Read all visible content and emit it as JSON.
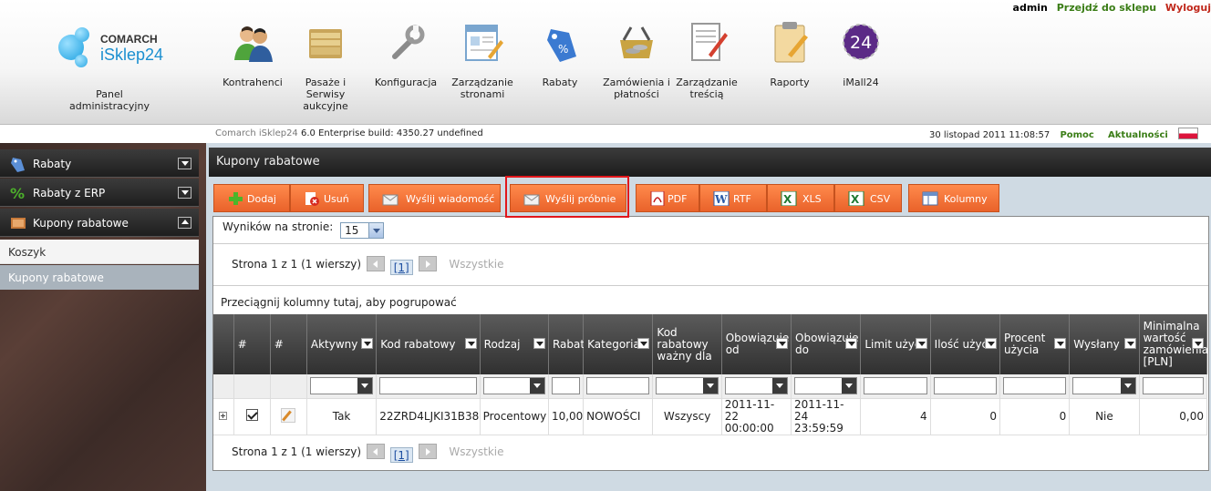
{
  "user_links": {
    "user": "admin",
    "shop": "Przejdź do sklepu",
    "logout": "Wyloguj"
  },
  "logo": {
    "brand": "COMARCH",
    "product": "iSklep24",
    "panel": "Panel administracyjny"
  },
  "nav": [
    {
      "label": "Kontrahenci",
      "icon": "contractors-icon"
    },
    {
      "label": "Pasaże i Serwisy aukcyjne",
      "icon": "auction-folder-icon"
    },
    {
      "label": "Konfiguracja",
      "icon": "wrench-icon"
    },
    {
      "label": "Zarządzanie stronami",
      "icon": "pages-icon"
    },
    {
      "label": "Rabaty",
      "icon": "discount-tag-icon"
    },
    {
      "label": "Zamówienia i płatności",
      "icon": "orders-basket-icon"
    },
    {
      "label": "Zarządzanie treścią",
      "icon": "content-edit-icon"
    },
    {
      "label": "Raporty",
      "icon": "reports-clipboard-icon"
    },
    {
      "label": "iMall24",
      "icon": "imall24-icon"
    }
  ],
  "status": {
    "build_prefix": "Comarch iSklep24",
    "build": "6.0 Enterprise build: 4350.27  undefined",
    "datetime": "30 listopad 2011 11:08:57",
    "help": "Pomoc",
    "news": "Aktualności"
  },
  "sidebar": {
    "sections": [
      {
        "label": "Rabaty",
        "icon": "discount-tag-icon"
      },
      {
        "label": "Rabaty z ERP",
        "icon": "percent-icon"
      },
      {
        "label": "Kupony rabatowe",
        "icon": "coupon-icon"
      }
    ],
    "items": [
      {
        "label": "Koszyk"
      },
      {
        "label": "Kupony rabatowe"
      }
    ]
  },
  "main": {
    "title": "Kupony rabatowe",
    "toolbar": {
      "add": "Dodaj",
      "delete": "Usuń",
      "send": "Wyślij wiadomość",
      "send_test": "Wyślij próbnie",
      "pdf": "PDF",
      "rtf": "RTF",
      "xls": "XLS",
      "csv": "CSV",
      "columns": "Kolumny"
    },
    "per_page_label": "Wyników na stronie:",
    "per_page_value": "15",
    "pager": {
      "text": "Strona 1 z 1 (1 wierszy)",
      "current": "[1]",
      "all": "Wszystkie"
    },
    "group_hint": "Przeciągnij kolumny tutaj, aby pogrupować",
    "columns": [
      "#",
      "#",
      "Aktywny",
      "Kod rabatowy",
      "Rodzaj",
      "Rabat",
      "Kategoria",
      "Kod rabatowy ważny dla",
      "Obowiązuje od",
      "Obowiązuje do",
      "Limit użyć",
      "Ilość użyć",
      "Procent użycia",
      "Wysłany",
      "Minimalna wartość zamówienia [PLN]"
    ],
    "row": {
      "active": "Tak",
      "code": "22ZRD4LJKI31B38",
      "type": "Procentowy",
      "discount": "10,00",
      "category": "NOWOŚCI",
      "valid_for": "Wszyscy",
      "from_date": "2011-11-22",
      "from_time": "00:00:00",
      "to_date": "2011-11-24",
      "to_time": "23:59:59",
      "limit": "4",
      "uses": "0",
      "percent": "0",
      "sent": "Nie",
      "min_value": "0,00"
    }
  }
}
